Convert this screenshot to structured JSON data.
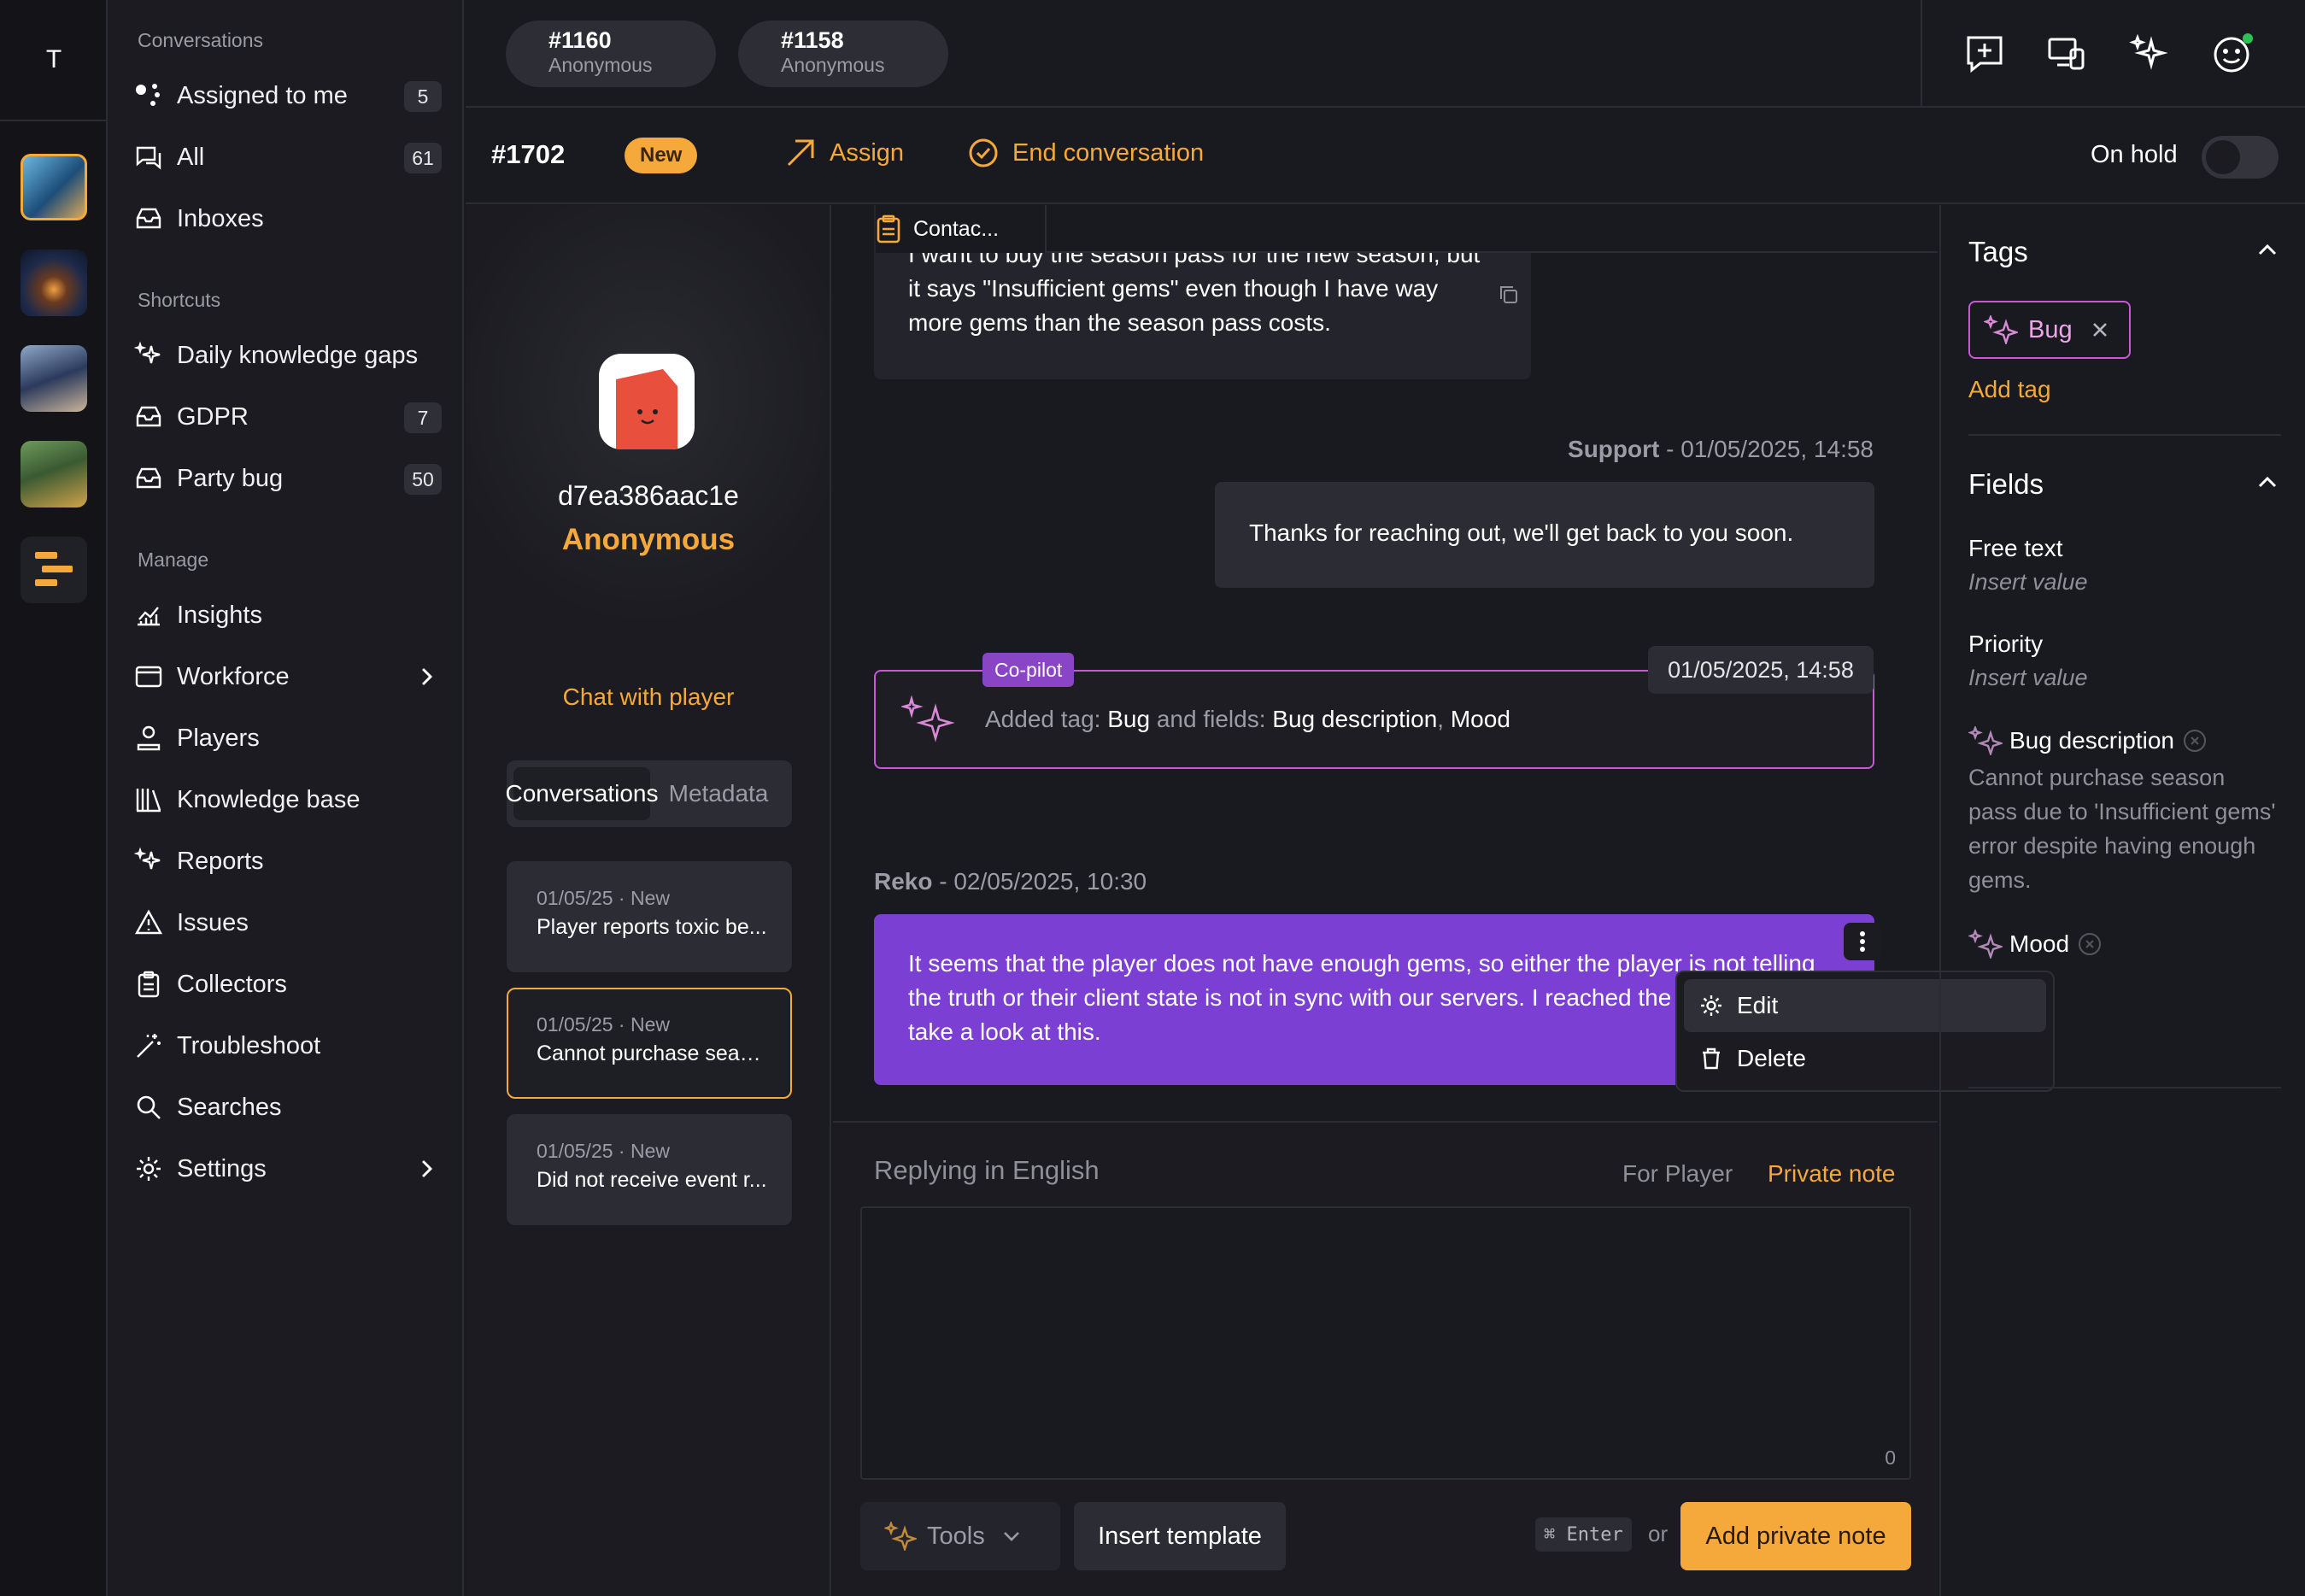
{
  "rail": {
    "avatar_letter": "T"
  },
  "sidebar": {
    "conversations_heading": "Conversations",
    "items": [
      {
        "label": "Assigned to me",
        "count": "5"
      },
      {
        "label": "All",
        "count": "61"
      },
      {
        "label": "Inboxes"
      }
    ],
    "shortcuts_heading": "Shortcuts",
    "shortcuts": [
      {
        "label": "Daily knowledge gaps"
      },
      {
        "label": "GDPR",
        "count": "7"
      },
      {
        "label": "Party bug",
        "count": "50"
      }
    ],
    "manage_heading": "Manage",
    "manage": [
      {
        "label": "Insights"
      },
      {
        "label": "Workforce"
      },
      {
        "label": "Players"
      },
      {
        "label": "Knowledge base"
      },
      {
        "label": "Reports"
      },
      {
        "label": "Issues"
      },
      {
        "label": "Collectors"
      },
      {
        "label": "Troubleshoot"
      },
      {
        "label": "Searches"
      },
      {
        "label": "Settings"
      }
    ]
  },
  "top_tabs": [
    {
      "id": "#1160",
      "sub": "Anonymous"
    },
    {
      "id": "#1158",
      "sub": "Anonymous"
    }
  ],
  "header": {
    "id": "#1702",
    "badge": "New",
    "assign": "Assign",
    "end": "End conversation",
    "on_hold": "On hold"
  },
  "profile": {
    "player_id": "d7ea386aac1e",
    "name": "Anonymous",
    "chat_link": "Chat with player",
    "tabs": [
      "Conversations",
      "Metadata"
    ],
    "cards": [
      {
        "date": "01/05/25 · New",
        "title": "Player reports toxic be..."
      },
      {
        "date": "01/05/25 · New",
        "title": "Cannot purchase seas..."
      },
      {
        "date": "01/05/25 · New",
        "title": "Did not receive event r..."
      }
    ]
  },
  "chat": {
    "contact_tab": "Contac...",
    "player_msg": "I want to buy the season pass for the new season, but it says \"Insufficient gems\" even though I have way more gems than the season pass costs.",
    "support_author": "Support",
    "support_time": " - 01/05/2025, 14:58",
    "support_msg": "Thanks for reaching out, we'll get back to you soon.",
    "copilot_badge": "Co-pilot",
    "copilot_time": "01/05/2025, 14:58",
    "copilot_pre": "Added tag: ",
    "copilot_tag": "Bug",
    "copilot_mid": " and fields: ",
    "copilot_f1": "Bug description",
    "copilot_sep": ", ",
    "copilot_f2": "Mood",
    "reko_author": "Reko",
    "reko_time": " - 02/05/2025, 10:30",
    "reko_msg": "It seems that the player does not have enough gems, so either the player is not telling the truth or their client state is not in sync with our servers. I reached the dev team to take a look at this.",
    "menu": [
      "Edit",
      "Delete"
    ]
  },
  "reply": {
    "label": "Replying in English",
    "for_player": "For Player",
    "private_note": "Private note",
    "char_count": "0",
    "tools": "Tools",
    "insert_template": "Insert template",
    "shortcut": "⌘ Enter",
    "or": "or",
    "submit": "Add private note"
  },
  "right": {
    "tags_heading": "Tags",
    "tag": "Bug",
    "add_tag": "Add tag",
    "fields_heading": "Fields",
    "free_text_label": "Free text",
    "free_text_value": "Insert value",
    "priority_label": "Priority",
    "priority_value": "Insert value",
    "bug_desc_label": "Bug description",
    "bug_desc_value": "Cannot purchase season pass due to 'Insufficient gems' error despite having enough gems.",
    "mood_label": "Mood"
  },
  "colors": {
    "accent": "#f6a93b",
    "copilot": "#c957d6",
    "reko": "#7b3fd4"
  }
}
